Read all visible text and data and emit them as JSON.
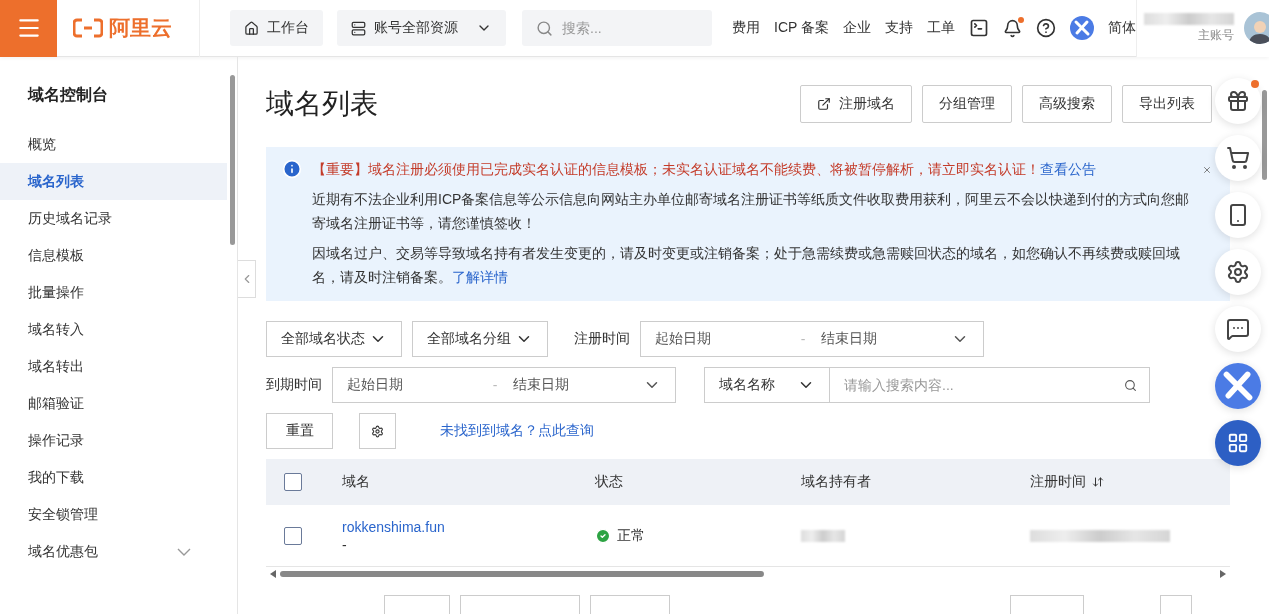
{
  "topbar": {
    "logo": "阿里云",
    "workbench": "工作台",
    "resources": "账号全部资源",
    "search": {
      "placeholder": "搜索..."
    },
    "links": [
      "费用",
      "ICP 备案",
      "企业",
      "支持",
      "工单"
    ],
    "bell_dot": true,
    "language": "简体",
    "account_role": "主账号"
  },
  "sidebar": {
    "title": "域名控制台",
    "items": [
      {
        "label": "概览",
        "selected": false
      },
      {
        "label": "域名列表",
        "selected": true
      },
      {
        "label": "历史域名记录",
        "selected": false
      },
      {
        "label": "信息模板",
        "selected": false
      },
      {
        "label": "批量操作",
        "selected": false
      },
      {
        "label": "域名转入",
        "selected": false
      },
      {
        "label": "域名转出",
        "selected": false
      },
      {
        "label": "邮箱验证",
        "selected": false
      },
      {
        "label": "操作记录",
        "selected": false
      },
      {
        "label": "我的下载",
        "selected": false
      },
      {
        "label": "安全锁管理",
        "selected": false
      },
      {
        "label": "域名优惠包",
        "selected": false,
        "expanded": false
      }
    ]
  },
  "page": {
    "title": "域名列表",
    "actions": [
      {
        "label": "注册域名",
        "kind": "external"
      },
      {
        "label": "分组管理",
        "kind": "plain"
      },
      {
        "label": "高级搜索",
        "kind": "plain"
      },
      {
        "label": "导出列表",
        "kind": "plain"
      }
    ]
  },
  "notice": {
    "headline": "【重要】域名注册必须使用已完成实名认证的信息模板；未实名认证域名不能续费、将被暂停解析，请立即实名认证！",
    "headline_link": "查看公告",
    "paragraph_1": "近期有不法企业利用ICP备案信息等公示信息向网站主办单位邮寄域名注册证书等纸质文件收取费用获利，阿里云不会以快递到付的方式向您邮寄域名注册证书等，请您谨慎签收！",
    "paragraph_2": "因域名过户、交易等导致域名持有者发生变更的，请及时变更或注销备案；处于急需续费或急需赎回状态的域名，如您确认不再续费或赎回域名，请及时注销备案。",
    "paragraph_2_link": "了解详情"
  },
  "filters": {
    "status_select": "全部域名状态",
    "group_select": "全部域名分组",
    "reg_time_label": "注册时间",
    "reg_start": "起始日期",
    "reg_sep": "-",
    "reg_end": "结束日期",
    "exp_time_label": "到期时间",
    "exp_start": "起始日期",
    "exp_sep": "-",
    "exp_end": "结束日期",
    "field_select": "域名名称",
    "search": {
      "placeholder": "请输入搜索内容..."
    },
    "reset": "重置",
    "not_found_link": "未找到到域名？点此查询"
  },
  "table": {
    "columns": [
      "域名",
      "状态",
      "域名持有者",
      "注册时间"
    ],
    "header_checked": false,
    "rows": [
      {
        "checked": false,
        "domain": "rokkenshima.fun",
        "remark": "-",
        "status": "正常"
      }
    ]
  }
}
